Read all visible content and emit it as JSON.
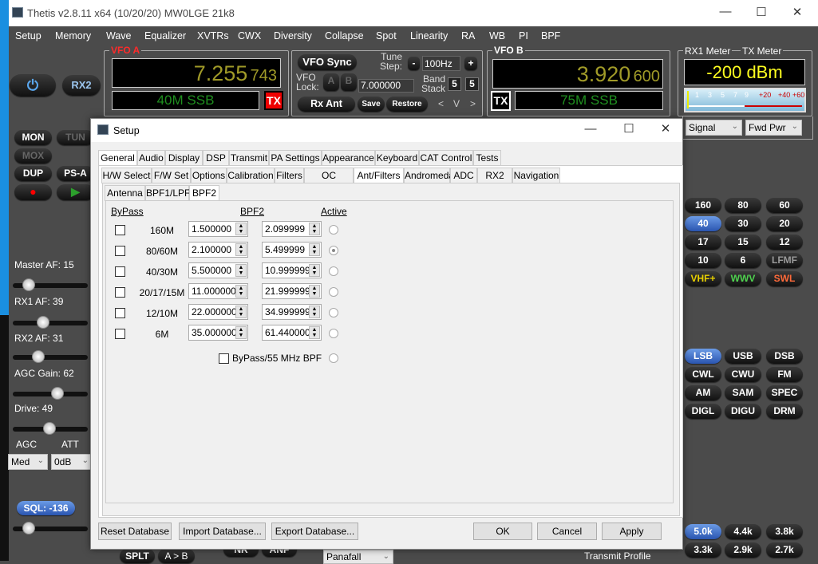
{
  "app": {
    "title": "Thetis v2.8.11 x64 (10/20/20) MW0LGE 21k8"
  },
  "menu": [
    "Setup",
    "Memory",
    "Wave",
    "Equalizer",
    "XVTRs",
    "CWX",
    "Diversity",
    "Collapse",
    "Spot",
    "Linearity",
    "RA",
    "WB",
    "PI",
    "BPF"
  ],
  "vfo_a": {
    "label": "VFO A",
    "freq_main": "7.255",
    "freq_sub": "743",
    "mode": "40M SSB",
    "tx": "TX"
  },
  "vfo_b": {
    "label": "VFO B",
    "freq_main": "3.920",
    "freq_sub": "600",
    "mode": "75M SSB",
    "tx": "TX"
  },
  "vfo_ctrl": {
    "sync": "VFO Sync",
    "lock": "VFO\nLock:",
    "lock_a": "A",
    "lock_b": "B",
    "lock_freq": "7.000000",
    "tune_step_label": "Tune Step:",
    "minus": "-",
    "plus": "+",
    "tune_step": "100Hz",
    "band_stack_label": "Band Stack",
    "bs1": "5",
    "bs2": "5",
    "rx_ant": "Rx Ant",
    "save": "Save",
    "restore": "Restore",
    "nav_prev": "<",
    "nav_v": "V",
    "nav_next": ">"
  },
  "meter": {
    "rx_label": "RX1 Meter",
    "tx_label": "TX Meter",
    "reading": "-200 dBm",
    "scale": [
      "1",
      "3",
      "5",
      "7",
      "9",
      "+20",
      "+40",
      "+60"
    ],
    "rx_select": "Signal",
    "tx_select": "Fwd Pwr"
  },
  "left": {
    "power": "power",
    "rx2": "RX2",
    "buttons": [
      {
        "label": "MON",
        "dim": false
      },
      {
        "label": "TUN",
        "dim": true
      },
      {
        "label": "MOX",
        "dim": true
      },
      {
        "label": "DUP",
        "dim": false
      },
      {
        "label": "PS-A",
        "dim": false
      }
    ],
    "sliders": [
      {
        "label": "Master AF:  15",
        "value": 15
      },
      {
        "label": "RX1 AF:  39",
        "value": 39
      },
      {
        "label": "RX2 AF:  31",
        "value": 31
      },
      {
        "label": "AGC Gain:  62",
        "value": 62
      },
      {
        "label": "Drive:  49",
        "value": 49
      }
    ],
    "agc_label": "AGC",
    "att_label": "ATT",
    "agc_value": "Med",
    "att_value": "0dB",
    "sql": "SQL: -136",
    "sql_value": 15
  },
  "bands": [
    {
      "l": "160"
    },
    {
      "l": "80"
    },
    {
      "l": "60"
    },
    {
      "l": "40",
      "on": true
    },
    {
      "l": "30"
    },
    {
      "l": "20"
    },
    {
      "l": "17"
    },
    {
      "l": "15"
    },
    {
      "l": "12"
    },
    {
      "l": "10"
    },
    {
      "l": "6"
    },
    {
      "l": "LFMF",
      "c": "#9a9a9a"
    },
    {
      "l": "VHF+",
      "c": "#e8d000"
    },
    {
      "l": "WWV",
      "c": "#4fd24f"
    },
    {
      "l": "SWL",
      "c": "#ff6a3a"
    }
  ],
  "modes": [
    {
      "l": "LSB",
      "on": true
    },
    {
      "l": "USB"
    },
    {
      "l": "DSB"
    },
    {
      "l": "CWL"
    },
    {
      "l": "CWU"
    },
    {
      "l": "FM"
    },
    {
      "l": "AM"
    },
    {
      "l": "SAM"
    },
    {
      "l": "SPEC"
    },
    {
      "l": "DIGL"
    },
    {
      "l": "DIGU"
    },
    {
      "l": "DRM"
    }
  ],
  "filters": [
    {
      "l": "5.0k",
      "on": true
    },
    {
      "l": "4.4k"
    },
    {
      "l": "3.8k"
    },
    {
      "l": "3.3k"
    },
    {
      "l": "2.9k"
    },
    {
      "l": "2.7k"
    }
  ],
  "bottom": {
    "splt": "SPLT",
    "atob": "A > B",
    "nr": "NR",
    "anf": "ANF",
    "display_mode": "Panafall",
    "transmit_profile": "Transmit Profile"
  },
  "setup": {
    "title": "Setup",
    "tabs1": [
      "General",
      "Audio",
      "Display",
      "DSP",
      "Transmit",
      "PA Settings",
      "Appearance",
      "Keyboard",
      "CAT Control",
      "Tests"
    ],
    "tabs2": [
      "H/W Select",
      "F/W Set",
      "Options",
      "Calibration",
      "Filters",
      "OC Control",
      "Ant/Filters",
      "Andromeda",
      "ADC",
      "RX2",
      "Navigation"
    ],
    "tabs3": [
      "Antenna",
      "BPF1/LPF",
      "BPF2"
    ],
    "col_bypass": "ByPass",
    "col_bpf2": "BPF2",
    "col_active": "Active",
    "rows": [
      {
        "band": "160M",
        "start": "1.500000",
        "end": "2.099999",
        "bypass": false,
        "active": false
      },
      {
        "band": "80/60M",
        "start": "2.100000",
        "end": "5.499999",
        "bypass": false,
        "active": true
      },
      {
        "band": "40/30M",
        "start": "5.500000",
        "end": "10.999999",
        "bypass": false,
        "active": false
      },
      {
        "band": "20/17/15M",
        "start": "11.000000",
        "end": "21.999999",
        "bypass": false,
        "active": false
      },
      {
        "band": "12/10M",
        "start": "22.000000",
        "end": "34.999999",
        "bypass": false,
        "active": false
      },
      {
        "band": "6M",
        "start": "35.000000",
        "end": "61.440000",
        "bypass": false,
        "active": false
      }
    ],
    "bypass55": "ByPass/55 MHz BPF",
    "reset": "Reset Database",
    "import": "Import Database...",
    "export": "Export Database...",
    "ok": "OK",
    "cancel": "Cancel",
    "apply": "Apply"
  }
}
